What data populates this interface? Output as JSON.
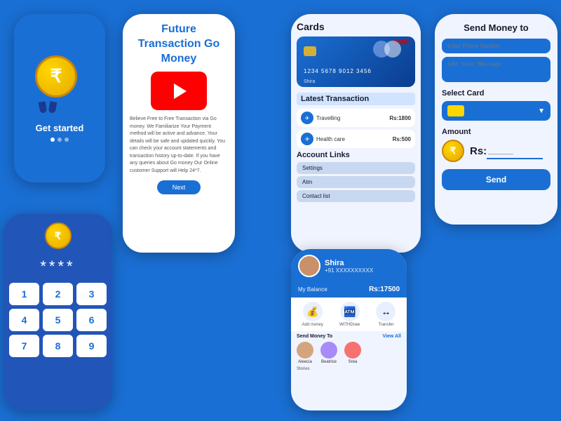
{
  "phone1": {
    "get_started": "Get started",
    "coin_symbol": "₹"
  },
  "phone2": {
    "pin_display": "****",
    "keys": [
      "1",
      "2",
      "3",
      "4",
      "5",
      "6",
      "7",
      "8",
      "9"
    ],
    "coin_symbol": "₹"
  },
  "phone3": {
    "title": "Future Transaction Go Money",
    "description": "Believe Free to Free Transaction via Go money.\nWe Familiarize Your Payment method will be active and advance.\nYour details will be safe and updated quickly.\nYou can check your account statements and transaction history up-to-date.\nIf you have any queries about Go money Our Online customer Support will Help 24*7.",
    "next_label": "Next"
  },
  "phone4": {
    "cards_title": "Cards",
    "card_number": "1234  5678  9012  3456",
    "card_name": "Shira",
    "card_bank": "HSBC",
    "latest_tx_title": "Latest Transaction",
    "transactions": [
      {
        "name": "Travelling",
        "amount": "Rs:1800",
        "icon": "✈"
      },
      {
        "name": "Health care",
        "amount": "Rs:500",
        "icon": "+"
      }
    ],
    "account_links_title": "Account Links",
    "account_links": [
      "Settings",
      "Atm",
      "Contact list"
    ]
  },
  "phone5": {
    "profile_name": "Shira",
    "profile_phone": "+91 XXXXXXXXXX",
    "balance_label": "My Balance",
    "balance_amount": "Rs:17500",
    "actions": [
      {
        "label": "Add money",
        "icon": "💰"
      },
      {
        "label": "WITHDraw",
        "icon": "🏧"
      },
      {
        "label": "Transfer",
        "icon": "↔"
      }
    ],
    "send_money_label": "Send Money To",
    "view_all_label": "View All",
    "contacts": [
      {
        "name": "Aleecia"
      },
      {
        "name": "Beatrice"
      },
      {
        "name": "Srea"
      }
    ],
    "stories_label": "Stories"
  },
  "phone6": {
    "title": "Send Money to",
    "phone_placeholder": "Enter Phone Number",
    "message_placeholder": "Add Your Message",
    "select_card_title": "Select Card",
    "amount_title": "Amount",
    "amount_prefix": "Rs:",
    "amount_value": "____",
    "send_label": "Send"
  }
}
